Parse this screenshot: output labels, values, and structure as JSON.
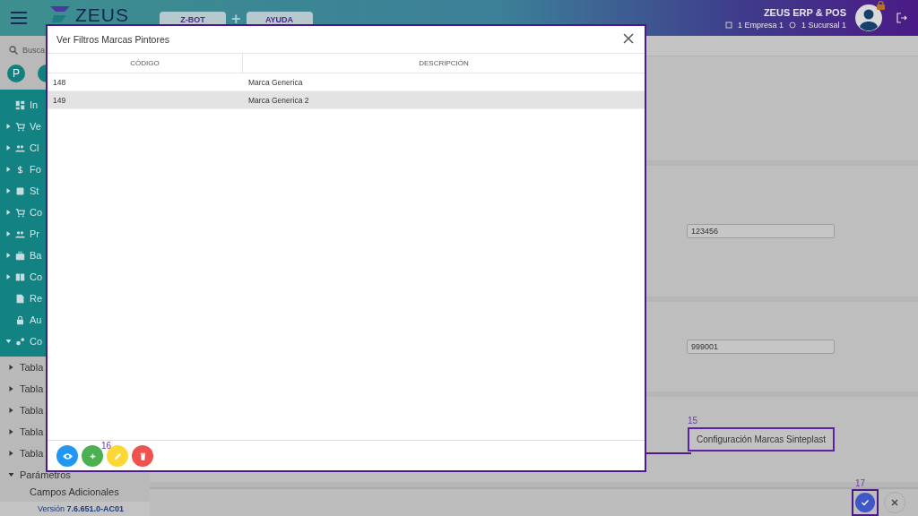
{
  "header": {
    "logo": "ZEUS",
    "tabs": [
      {
        "label": "Z-BOT"
      },
      {
        "label": "AYUDA"
      }
    ],
    "tab_separator": "+",
    "app_name": "ZEUS ERP & POS",
    "company": "1 Empresa 1",
    "branch": "1 Sucursal 1"
  },
  "sidebar": {
    "search_placeholder": "Busca",
    "avatars": [
      {
        "letter": "P"
      }
    ],
    "menu": [
      {
        "label": "In",
        "kind": "dashboard"
      },
      {
        "label": "Ve",
        "kind": "cart",
        "expanded": false
      },
      {
        "label": "Cl",
        "kind": "people",
        "expanded": false
      },
      {
        "label": "Fo",
        "kind": "dollar",
        "expanded": false
      },
      {
        "label": "St",
        "kind": "box",
        "expanded": false
      },
      {
        "label": "Co",
        "kind": "cart",
        "expanded": false
      },
      {
        "label": "Pr",
        "kind": "people",
        "expanded": false
      },
      {
        "label": "Ba",
        "kind": "briefcase",
        "expanded": false
      },
      {
        "label": "Co",
        "kind": "book",
        "expanded": false
      },
      {
        "label": "Re",
        "kind": "report"
      },
      {
        "label": "Au",
        "kind": "lock"
      },
      {
        "label": "Co",
        "kind": "gears",
        "expanded": true
      }
    ],
    "submenu": [
      {
        "label": "Tabla",
        "expanded": false
      },
      {
        "label": "Tabla",
        "expanded": false
      },
      {
        "label": "Tabla",
        "expanded": false
      },
      {
        "label": "Tabla",
        "expanded": false
      },
      {
        "label": "Tabla",
        "expanded": false
      },
      {
        "label": "Parámetros",
        "expanded": true,
        "children": [
          {
            "label": "Campos Adicionales"
          }
        ]
      }
    ],
    "version": "Versión **7.6.651.0-AC01**"
  },
  "main": {
    "fields": [
      {
        "value": "123456"
      },
      {
        "value": "999001"
      }
    ],
    "config_button": {
      "label": "Configuración Marcas Sinteplast",
      "annotation": "15"
    },
    "confirm_annotation": "17"
  },
  "dialog": {
    "title": "Ver Filtros Marcas Pintores",
    "columns": [
      "CÓDIGO",
      "DESCRIPCIÓN"
    ],
    "rows": [
      {
        "code": "148",
        "description": "Marca Generica",
        "selected": false
      },
      {
        "code": "149",
        "description": "Marca Generica 2",
        "selected": true
      }
    ],
    "actions": [
      {
        "kind": "view",
        "color": "#2196f3"
      },
      {
        "kind": "add",
        "color": "#4caf50"
      },
      {
        "kind": "edit",
        "color": "#fdd835"
      },
      {
        "kind": "delete",
        "color": "#ef5350"
      }
    ],
    "actions_annotation": "16"
  }
}
